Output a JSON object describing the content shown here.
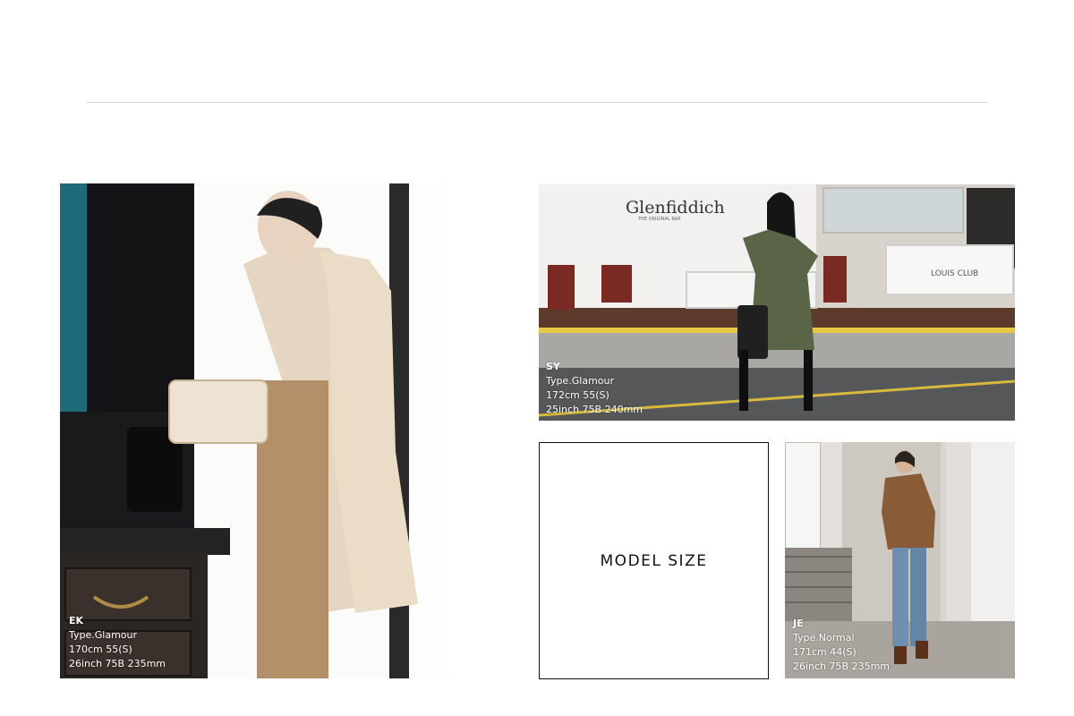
{
  "model_size_label": "MODEL SIZE",
  "models": [
    {
      "code": "EK",
      "type": "Type.Glamour",
      "measure1": "170cm 55(S)",
      "measure2": "26inch 75B 235mm"
    },
    {
      "code": "SY",
      "type": "Type.Glamour",
      "measure1": "172cm 55(S)",
      "measure2": "25inch 75B 240mm"
    },
    {
      "code": "JE",
      "type": "Type.Normal",
      "measure1": "171cm 44(S)",
      "measure2": "26inch 75B 235mm"
    }
  ],
  "signage": {
    "glenfiddich": "Glenfiddich",
    "glenfiddich_sub": "THE ORIGINAL BAR",
    "louis_club": "LOUIS CLUB"
  }
}
